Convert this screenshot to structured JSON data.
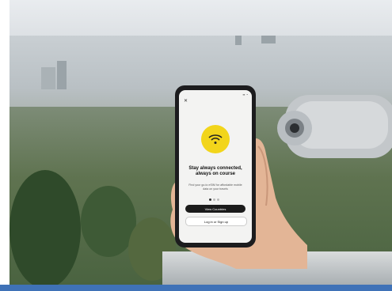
{
  "phone_ui": {
    "headline": "Stay always connected, always on course",
    "subtext": "Find your go-to eSIM for affordable mobile data on your travels",
    "primary_button": "View Countries",
    "secondary_button": "Log in or Sign up",
    "wifi_icon": "wifi-icon",
    "close_icon": "close-icon"
  },
  "colors": {
    "accent_yellow": "#f2d51b",
    "button_dark": "#1b1b1b",
    "bottom_bar": "#3f72b7"
  }
}
